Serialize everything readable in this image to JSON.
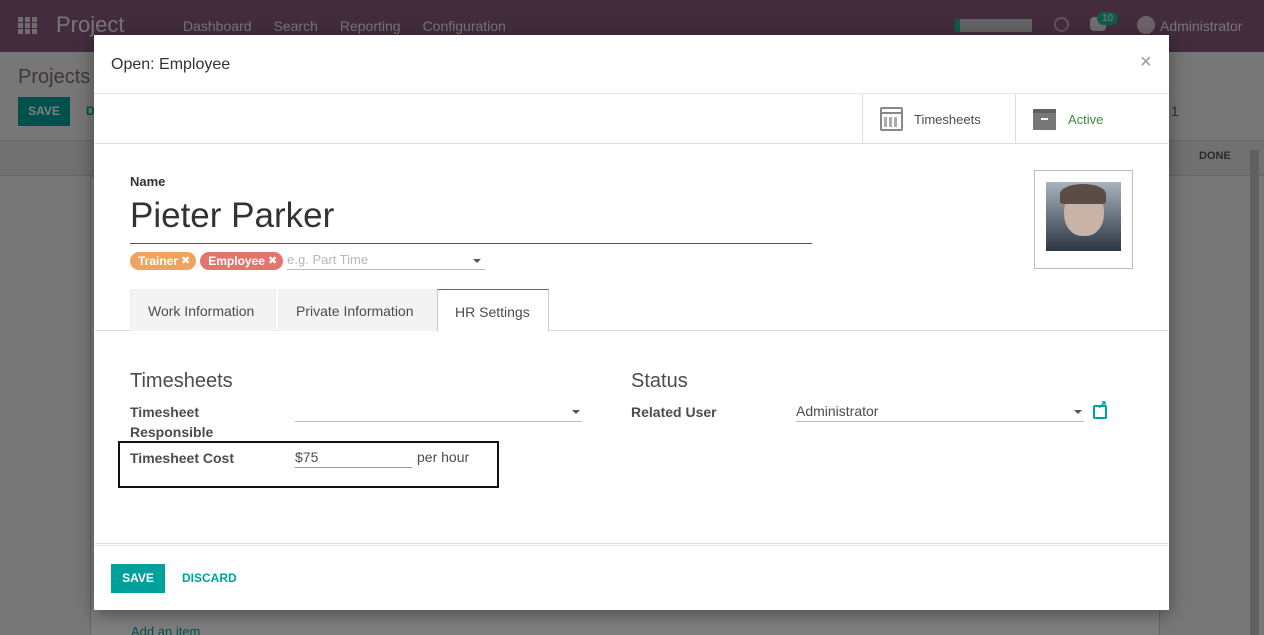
{
  "navbar": {
    "brand": "Project",
    "menu": [
      "Dashboard",
      "Search",
      "Reporting",
      "Configuration"
    ],
    "notification_count": "10",
    "user": "Administrator"
  },
  "background": {
    "title": "Projects",
    "save_label": "SAVE",
    "discard_partial": "D",
    "pager_partial": "1",
    "stage_done": "DONE",
    "add_item": "Add an item"
  },
  "modal": {
    "title": "Open: Employee",
    "close": "×",
    "stat_buttons": {
      "timesheets": "Timesheets",
      "active": "Active"
    },
    "name_label": "Name",
    "name_value": "Pieter Parker",
    "tags": [
      {
        "label": "Trainer",
        "color": "#f0a35e"
      },
      {
        "label": "Employee",
        "color": "#e2766f"
      }
    ],
    "tag_placeholder": "e.g. Part Time",
    "tabs": [
      "Work Information",
      "Private Information",
      "HR Settings"
    ],
    "active_tab": "HR Settings",
    "timesheets_section": {
      "title": "Timesheets",
      "responsible_label": "Timesheet Responsible",
      "responsible_value": "",
      "cost_label": "Timesheet Cost",
      "cost_value": "$75",
      "cost_unit": "per hour"
    },
    "status_section": {
      "title": "Status",
      "related_user_label": "Related User",
      "related_user_value": "Administrator"
    },
    "footer": {
      "save_label": "SAVE",
      "discard_label": "DISCARD"
    }
  },
  "colors": {
    "navbar": "#875a7b",
    "accent": "#00a09d",
    "active_status": "#3b8f3b"
  }
}
